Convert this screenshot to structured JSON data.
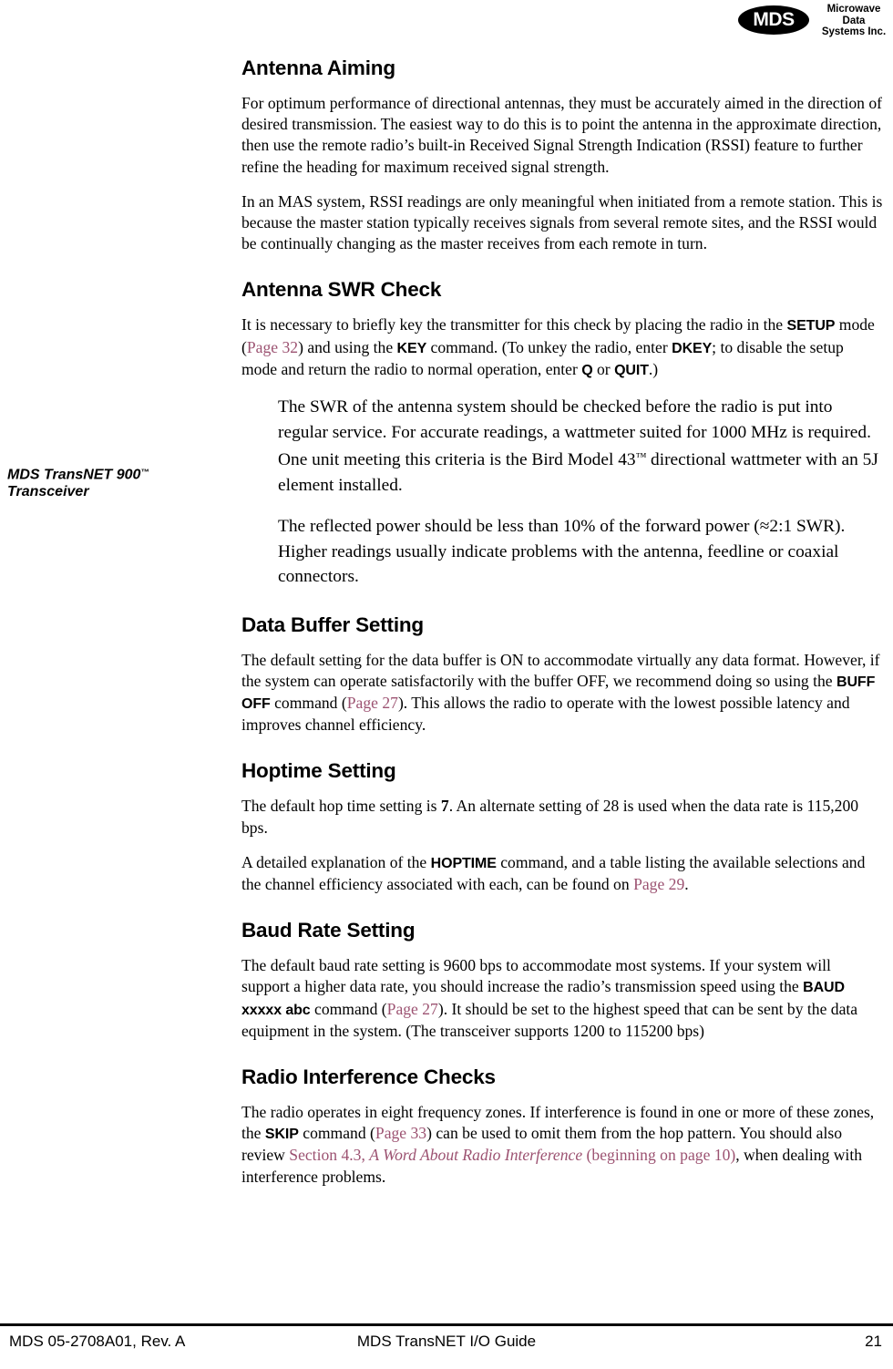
{
  "header": {
    "logo_mark_text": "MDS",
    "company_line1": "Microwave",
    "company_line2": "Data",
    "company_line3": "Systems Inc."
  },
  "margin_note": {
    "line1_pre": "MDS TransNET 900",
    "line1_tm": "™",
    "line2": "Transceiver"
  },
  "colors": {
    "xref": "#9c5271",
    "text": "#000000",
    "background": "#ffffff"
  },
  "sections": [
    {
      "heading": "Antenna Aiming",
      "paragraphs": [
        "For optimum performance of directional antennas, they must be accurately aimed in the direction of desired transmission. The easiest way to do this is to point the antenna in the approximate direction, then use the remote radio’s built-in Received Signal Strength Indication (RSSI) feature to further refine the heading for maximum received signal strength.",
        "In an MAS system, RSSI readings are only meaningful when initiated from a remote station. This is because the master station typically receives signals from several remote sites, and the RSSI would be continually changing as the master receives from each remote in turn."
      ]
    },
    {
      "heading": "Antenna SWR Check",
      "p1": {
        "t1": "It is necessary to briefly key the transmitter for this check by placing the radio in the ",
        "cmd1": "SETUP",
        "t2": " mode (",
        "xref1": "Page 32",
        "t3": ") and using the ",
        "cmd2": "KEY",
        "t4": " command. (To unkey the radio, enter ",
        "cmd3": "DKEY",
        "t5": "; to disable the setup mode and return the radio to normal operation, enter ",
        "cmd4": "Q",
        "t6": " or ",
        "cmd5": "QUIT",
        "t7": ".)"
      },
      "p_indent_1": {
        "t1": "The SWR of the antenna system should be checked before the radio is put into regular service. For accurate readings, a wattmeter suited for 1000 MHz is required. One unit meeting this criteria is the Bird Model 43",
        "tm": "™",
        "t2": " directional wattmeter with an 5J element installed."
      },
      "p_indent_2": "The reflected power should be less than 10% of the forward power (≈2:1 SWR). Higher readings usually indicate problems with the antenna, feedline or coaxial connectors."
    },
    {
      "heading": "Data Buffer Setting",
      "p1": {
        "t1": "The default setting for the data buffer is ON to accommodate virtually any data format. However, if the system can operate satisfactorily with the buffer OFF, we recommend doing so using the ",
        "cmd1": "BUFF OFF",
        "t2": " command (",
        "xref1": "Page 27",
        "t3": "). This allows the radio to operate with the lowest possible latency and improves channel efficiency."
      }
    },
    {
      "heading": "Hoptime Setting",
      "p1": {
        "t1": "The default hop time setting is ",
        "b1": "7",
        "t2": ". An alternate setting of 28 is used when the data rate is 115,200 bps."
      },
      "p2": {
        "t1": "A detailed explanation of the ",
        "cmd1": "HOPTIME",
        "t2": " command, and a table listing the available selections and the channel efficiency associated with each, can be found on ",
        "xref1": "Page 29",
        "t3": "."
      }
    },
    {
      "heading": "Baud Rate Setting",
      "p1": {
        "t1": "The default baud rate setting is 9600 bps to accommodate most systems. If your system will support a higher data rate, you should increase the radio’s transmission speed using the ",
        "cmd1": "BAUD xxxxx abc",
        "t2": " command (",
        "xref1": "Page 27",
        "t3": "). It should be set to the highest speed that can be sent by the data equipment in the system. (The transceiver supports 1200 to 115200 bps)"
      }
    },
    {
      "heading": "Radio Interference Checks",
      "p1": {
        "t1": "The radio operates in eight frequency zones. If interference is found in one or more of these zones, the ",
        "cmd1": "SKIP",
        "t2": " command (",
        "xref1": "Page 33",
        "t3": ") can be used to omit them from the hop pattern. You should also review ",
        "xref2": "Section 4.3, ",
        "xref3": "A Word About Radio Interference",
        "xref4": " (beginning on page 10)",
        "t4": ", when dealing with interference problems."
      }
    }
  ],
  "footer": {
    "left": "MDS 05-2708A01, Rev. A",
    "center": "MDS TransNET I/O Guide",
    "right": "21"
  }
}
